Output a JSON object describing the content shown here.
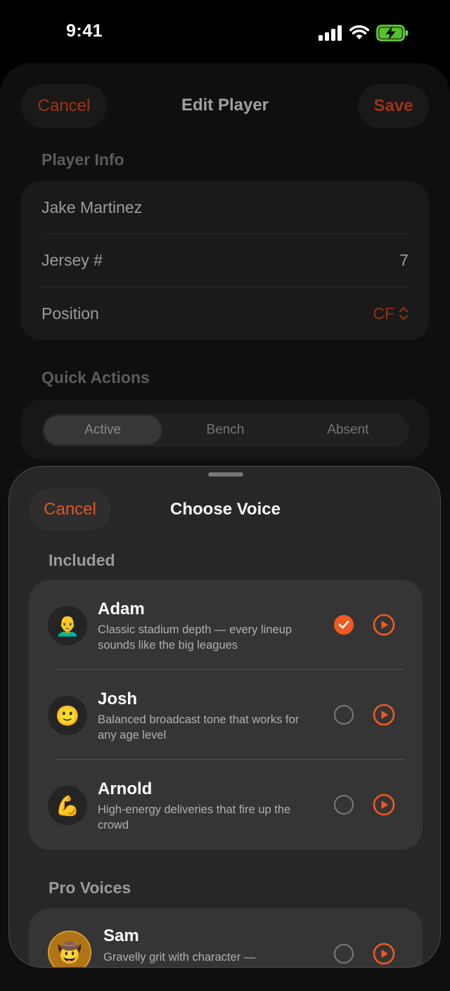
{
  "status_bar": {
    "time": "9:41"
  },
  "edit_player": {
    "cancel_label": "Cancel",
    "title": "Edit Player",
    "save_label": "Save",
    "player_info_label": "Player Info",
    "player_name": "Jake Martinez",
    "jersey_label": "Jersey #",
    "jersey_value": "7",
    "position_label": "Position",
    "position_value": "CF",
    "quick_actions_label": "Quick Actions",
    "status_options": [
      "Active",
      "Bench",
      "Absent"
    ],
    "selected_status": "Active"
  },
  "choose_voice": {
    "cancel_label": "Cancel",
    "title": "Choose Voice",
    "included_label": "Included",
    "pro_label": "Pro Voices",
    "included_voices": [
      {
        "name": "Adam",
        "description": "Classic stadium depth — every lineup sounds like the big leagues",
        "avatar": "👨‍🦲",
        "selected": true
      },
      {
        "name": "Josh",
        "description": "Balanced broadcast tone that works for any age level",
        "avatar": "🙂",
        "selected": false
      },
      {
        "name": "Arnold",
        "description": "High-energy deliveries that fire up the crowd",
        "avatar": "💪",
        "selected": false
      }
    ],
    "pro_voices": [
      {
        "name": "Sam",
        "description": "Gravelly grit with character —",
        "avatar": "🤠",
        "selected": false
      }
    ]
  },
  "colors": {
    "accent": "#ef5a21",
    "sheet_bg": "#282828",
    "card_bg": "#353535"
  }
}
